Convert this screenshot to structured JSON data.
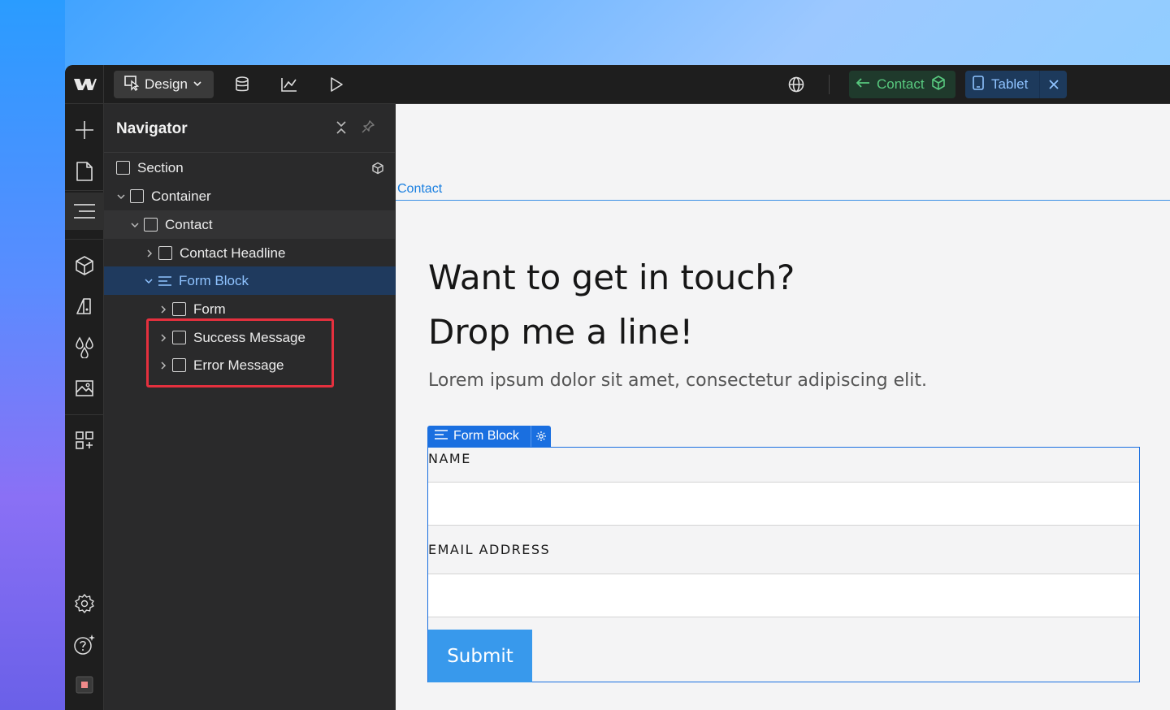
{
  "topbar": {
    "mode_label": "Design",
    "page_pill_label": "Contact",
    "breakpoint_label": "Tablet"
  },
  "navigator": {
    "title": "Navigator",
    "tree": [
      {
        "label": "Section"
      },
      {
        "label": "Container"
      },
      {
        "label": "Contact"
      },
      {
        "label": "Contact Headline"
      },
      {
        "label": "Form Block"
      },
      {
        "label": "Form"
      },
      {
        "label": "Success Message"
      },
      {
        "label": "Error Message"
      }
    ]
  },
  "canvas": {
    "section_label": "Contact",
    "headline_line1": "Want to get in touch?",
    "headline_line2": "Drop me a line!",
    "lede": "Lorem ipsum dolor sit amet, consectetur adipiscing elit.",
    "form_block_tag": "Form Block",
    "name_label": "NAME",
    "email_label": "EMAIL ADDRESS",
    "submit_label": "Submit"
  },
  "colors": {
    "selection_blue": "#1a6fe0",
    "highlight_red": "#e5303e",
    "page_green": "#58c97f"
  }
}
